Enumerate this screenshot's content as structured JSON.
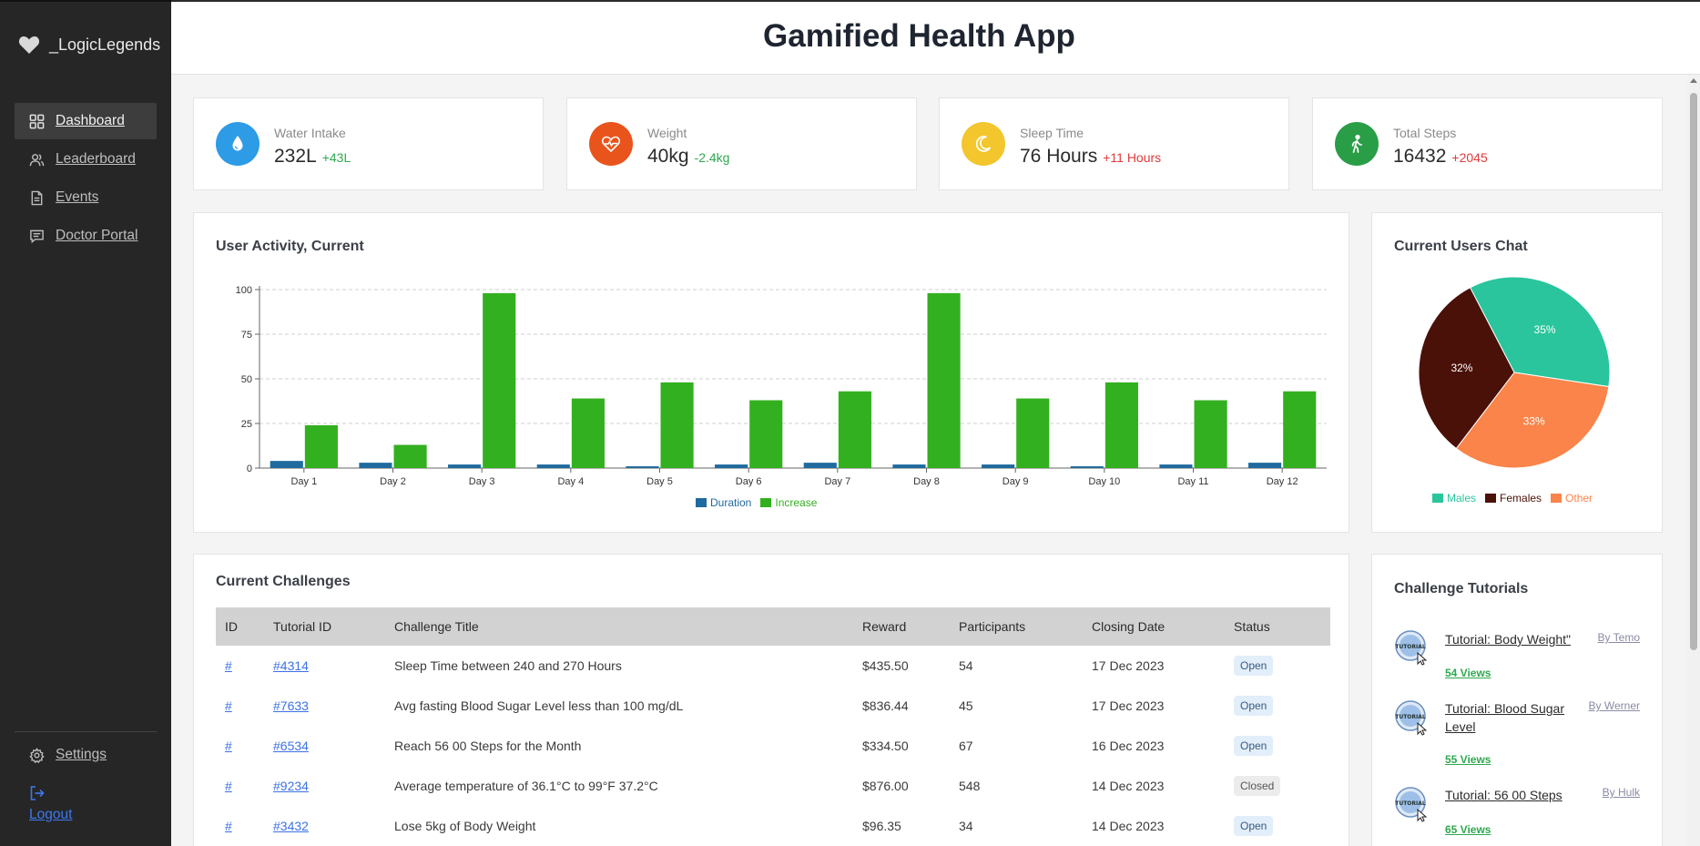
{
  "app": {
    "brand": "_LogicLegends",
    "title": "Gamified Health App"
  },
  "sidebar": {
    "items": [
      {
        "label": "Dashboard",
        "icon": "dashboard-icon",
        "active": true
      },
      {
        "label": "Leaderboard",
        "icon": "users-icon",
        "active": false
      },
      {
        "label": "Events",
        "icon": "document-icon",
        "active": false
      },
      {
        "label": "Doctor Portal",
        "icon": "chat-icon",
        "active": false
      }
    ],
    "settings": "Settings",
    "logout": "Logout"
  },
  "stats": [
    {
      "label": "Water Intake",
      "value": "232L",
      "delta": "+43L",
      "trend": "positive",
      "color": "#2d9be6",
      "icon": "water-drop-icon"
    },
    {
      "label": "Weight",
      "value": "40kg",
      "delta": "-2.4kg",
      "trend": "positive",
      "color": "#e8541c",
      "icon": "heart-pulse-icon"
    },
    {
      "label": "Sleep Time",
      "value": "76 Hours",
      "delta": "+11 Hours",
      "trend": "negative",
      "color": "#f2c62c",
      "icon": "moon-icon"
    },
    {
      "label": "Total Steps",
      "value": "16432",
      "delta": "+2045",
      "trend": "negative",
      "color": "#2a9d47",
      "icon": "walking-icon"
    }
  ],
  "activity": {
    "title": "User Activity, Current"
  },
  "chat": {
    "title": "Current Users Chat"
  },
  "chart_data": [
    {
      "type": "bar",
      "title": "User Activity, Current",
      "categories": [
        "Day 1",
        "Day 2",
        "Day 3",
        "Day 4",
        "Day 5",
        "Day 6",
        "Day 7",
        "Day 8",
        "Day 9",
        "Day 10",
        "Day 11",
        "Day 12"
      ],
      "series": [
        {
          "name": "Duration",
          "color": "#1f6a9e",
          "values": [
            4,
            3,
            2,
            2,
            1,
            2,
            3,
            2,
            2,
            1,
            2,
            3
          ]
        },
        {
          "name": "Increase",
          "color": "#33b01f",
          "values": [
            24,
            13,
            98,
            39,
            48,
            38,
            43,
            98,
            39,
            48,
            38,
            43
          ]
        }
      ],
      "yticks": [
        0,
        25,
        50,
        75,
        100
      ],
      "ylim": [
        0,
        100
      ],
      "grid": true,
      "legend": "bottom"
    },
    {
      "type": "pie",
      "title": "Current Users Chat",
      "slices": [
        {
          "name": "Males",
          "value": 35,
          "label": "35%",
          "color": "#2ac59c"
        },
        {
          "name": "Other",
          "value": 33,
          "label": "33%",
          "color": "#fa8449"
        },
        {
          "name": "Females",
          "value": 32,
          "label": "32%",
          "color": "#4a1109"
        }
      ],
      "legend_order": [
        "Males",
        "Females",
        "Other"
      ],
      "legend": "bottom"
    }
  ],
  "challenges": {
    "title": "Current Challenges",
    "columns": [
      "ID",
      "Tutorial ID",
      "Challenge Title",
      "Reward",
      "Participants",
      "Closing Date",
      "Status"
    ],
    "rows": [
      {
        "id": "#",
        "tutorial": "#4314",
        "title": "Sleep Time between 240 and 270 Hours",
        "reward": "$435.50",
        "participants": "54",
        "closing": "17 Dec 2023",
        "status": "Open"
      },
      {
        "id": "#",
        "tutorial": "#7633",
        "title": "Avg fasting Blood Sugar Level less than 100 mg/dL",
        "reward": "$836.44",
        "participants": "45",
        "closing": "17 Dec 2023",
        "status": "Open"
      },
      {
        "id": "#",
        "tutorial": "#6534",
        "title": "Reach 56 00 Steps for the Month",
        "reward": "$334.50",
        "participants": "67",
        "closing": "16 Dec 2023",
        "status": "Open"
      },
      {
        "id": "#",
        "tutorial": "#9234",
        "title": "Average temperature of 36.1°C to 99°F 37.2°C",
        "reward": "$876.00",
        "participants": "548",
        "closing": "14 Dec 2023",
        "status": "Closed"
      },
      {
        "id": "#",
        "tutorial": "#3432",
        "title": "Lose 5kg of Body Weight",
        "reward": "$96.35",
        "participants": "34",
        "closing": "14 Dec 2023",
        "status": "Open"
      }
    ]
  },
  "tutorials": {
    "title": "Challenge Tutorials",
    "items": [
      {
        "title": "Tutorial: Body Weight\"",
        "author": "By Temo",
        "views": "54 Views"
      },
      {
        "title": "Tutorial: Blood Sugar Level",
        "author": "By Werner",
        "views": "55 Views"
      },
      {
        "title": "Tutorial: 56 00 Steps",
        "author": "By Hulk",
        "views": "65 Views"
      }
    ],
    "thumb_text": "TUTORIAL"
  }
}
